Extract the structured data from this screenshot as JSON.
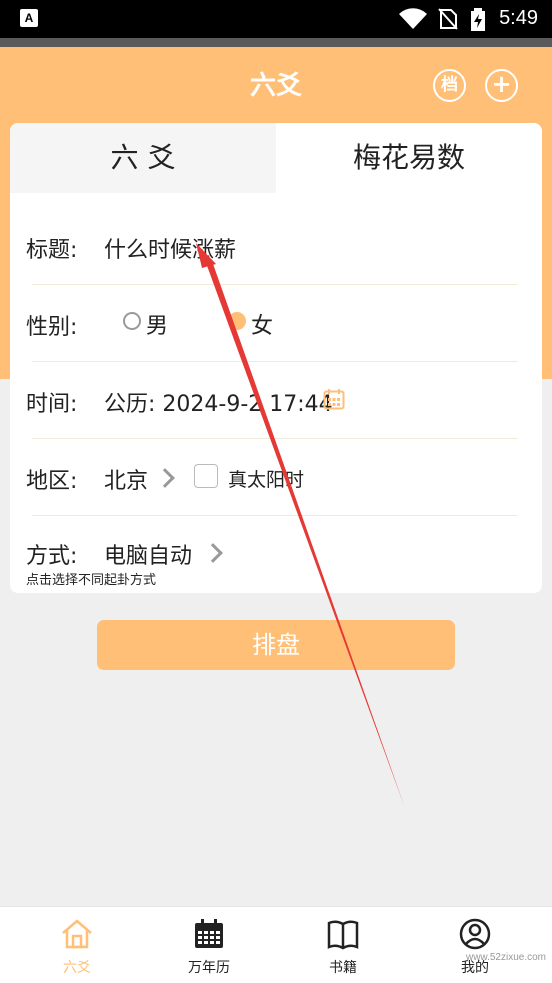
{
  "status_bar": {
    "badge": "A",
    "time": "5:49"
  },
  "header": {
    "title": "六爻",
    "archive_label": "档",
    "add_label": "+"
  },
  "tabs": [
    {
      "label": "六 爻"
    },
    {
      "label": "梅花易数"
    }
  ],
  "form": {
    "title": {
      "label": "标题:",
      "value": "什么时候涨薪"
    },
    "gender": {
      "label": "性别:",
      "option_male": "男",
      "option_female": "女",
      "selected": "女"
    },
    "time": {
      "label": "时间:",
      "value": "公历: 2024-9-2 17:44"
    },
    "region": {
      "label": "地区:",
      "value": "北京",
      "true_solar_label": "真太阳时",
      "true_solar_checked": false
    },
    "method": {
      "label": "方式:",
      "value": "电脑自动",
      "hint": "点击选择不同起卦方式"
    }
  },
  "submit_label": "排盘",
  "bottom_nav": [
    {
      "label": "六爻",
      "icon": "home-icon",
      "active": true
    },
    {
      "label": "万年历",
      "icon": "calendar-icon",
      "active": false
    },
    {
      "label": "书籍",
      "icon": "book-icon",
      "active": false
    },
    {
      "label": "我的",
      "icon": "user-icon",
      "active": false
    }
  ],
  "watermark": "www.52zixue.com",
  "colors": {
    "accent": "#ffbf76",
    "background": "#efefef",
    "arrow": "#e53935"
  }
}
